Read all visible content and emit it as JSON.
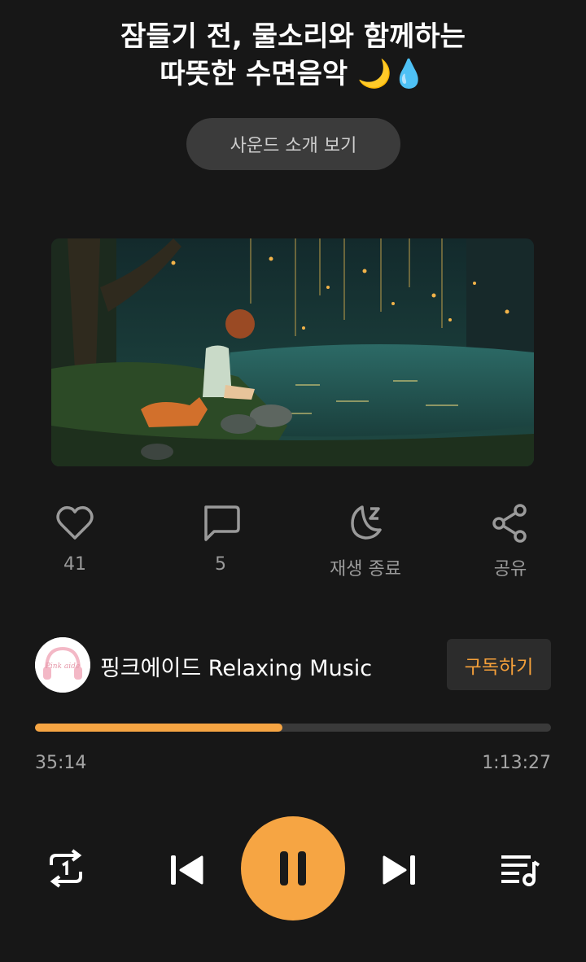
{
  "track": {
    "title_line1": "잠들기 전, 물소리와 함께하는",
    "title_line2": "따뜻한 수면음악 🌙💧",
    "intro_button": "사운드 소개 보기"
  },
  "actions": [
    {
      "icon": "heart-icon",
      "label": "41"
    },
    {
      "icon": "comment-icon",
      "label": "5"
    },
    {
      "icon": "sleep-timer-icon",
      "label": "재생 종료"
    },
    {
      "icon": "share-icon",
      "label": "공유"
    }
  ],
  "channel": {
    "name": "핑크에이드 Relaxing Music",
    "avatar_text": "Pink aide",
    "subscribe_label": "구독하기"
  },
  "player": {
    "current_time": "35:14",
    "total_time": "1:13:27",
    "progress": 0.48,
    "accent_color": "#f6a543"
  },
  "controls": [
    "repeat-one-icon",
    "previous-icon",
    "pause-icon",
    "next-icon",
    "playlist-icon"
  ]
}
